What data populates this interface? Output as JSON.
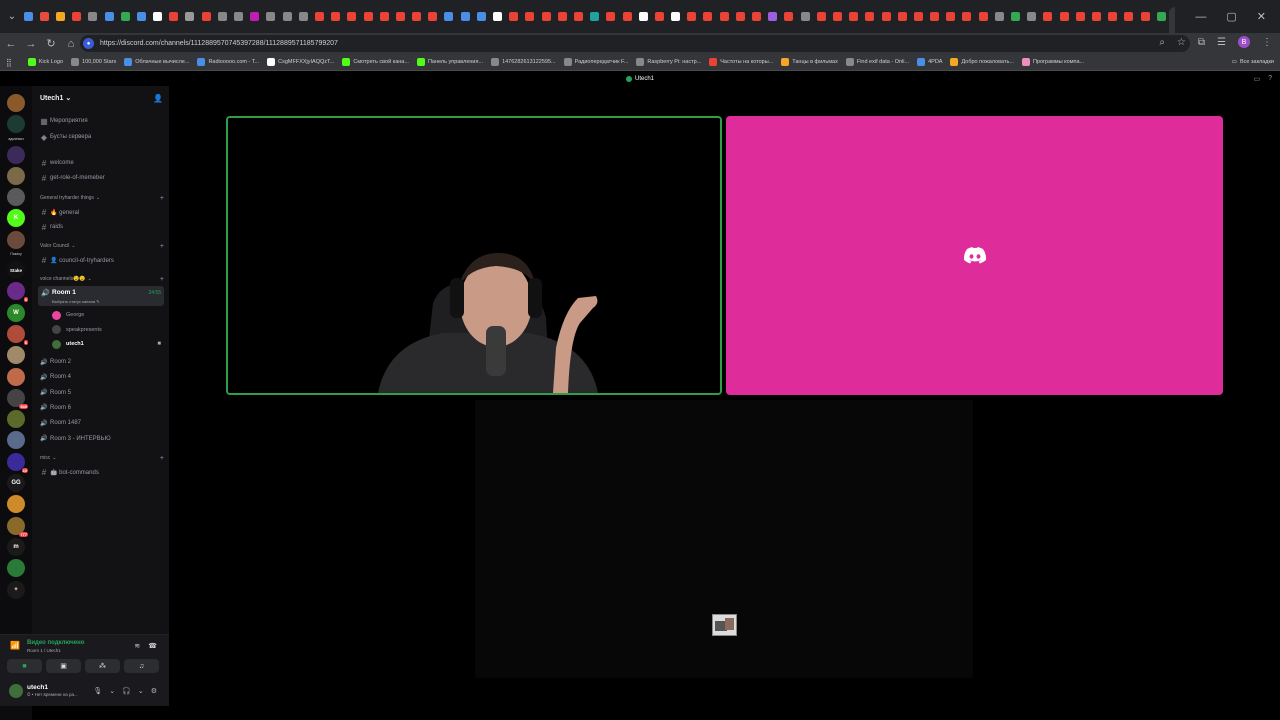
{
  "browser": {
    "url": "https://discord.com/channels/1112889570745397288/1112889571185799207",
    "tab_colors": [
      "#4a8fe7",
      "#e94c3d",
      "#f5a623",
      "#ea4335",
      "#888888",
      "#4a8fe7",
      "#34a853",
      "#4a8fe7",
      "#ffffff",
      "#ea4335",
      "#999999",
      "#ea4335",
      "#888888",
      "#888888",
      "#c21db2",
      "#888888",
      "#888888",
      "#888888",
      "#ea4335",
      "#ea4335",
      "#ea4335",
      "#ea4335",
      "#ea4335",
      "#ea4335",
      "#ea4335",
      "#ea4335",
      "#4a8fe7",
      "#4a8fe7",
      "#4a8fe7",
      "#ffffff",
      "#ea4335",
      "#ea4335",
      "#ea4335",
      "#ea4335",
      "#ea4335",
      "#20a39e",
      "#ea4335",
      "#ea4335",
      "#ffffff",
      "#ea4335",
      "#ffffff",
      "#ea4335",
      "#ea4335",
      "#ea4335",
      "#ea4335",
      "#ea4335",
      "#9c5fe0",
      "#ea4335",
      "#888888",
      "#ea4335",
      "#ea4335",
      "#ea4335",
      "#ea4335",
      "#ea4335",
      "#ea4335",
      "#ea4335",
      "#ea4335",
      "#ea4335",
      "#ea4335",
      "#ea4335",
      "#888888",
      "#34a853",
      "#888888",
      "#ea4335",
      "#ea4335",
      "#ea4335",
      "#ea4335",
      "#ea4335",
      "#ea4335",
      "#ea4335",
      "#34a853"
    ],
    "bookmarks": [
      {
        "label": "Kick Logo",
        "color": "#53fc18"
      },
      {
        "label": "100,000 Stars",
        "color": "#888888"
      },
      {
        "label": "Облачные вычисле...",
        "color": "#4a8fe7"
      },
      {
        "label": "Radiooooo.com - T...",
        "color": "#4a8fe7"
      },
      {
        "label": "CsgMFFXXjyIAQQzT...",
        "color": "#ffffff"
      },
      {
        "label": "Смотреть свой кана...",
        "color": "#53fc18"
      },
      {
        "label": "Панель управления...",
        "color": "#53fc18"
      },
      {
        "label": "1476282613122595...",
        "color": "#888888"
      },
      {
        "label": "Радиопередатчик F...",
        "color": "#888888"
      },
      {
        "label": "Raspberry Pi: настр...",
        "color": "#888888"
      },
      {
        "label": "Частоты на которы...",
        "color": "#ea4335"
      },
      {
        "label": "Танцы в фильмах",
        "color": "#f5a623"
      },
      {
        "label": "Find exif data - Onli...",
        "color": "#888888"
      },
      {
        "label": "4PDA",
        "color": "#4a8fe7"
      },
      {
        "label": "Добро пожаловать...",
        "color": "#f5a623"
      },
      {
        "label": "Программы компа...",
        "color": "#ea8fc0"
      }
    ],
    "bookmarks_right": "Все закладки",
    "profile_letter": "B"
  },
  "discord": {
    "top_title": "Utech1",
    "server_name": "Utech1",
    "servers": [
      {
        "kind": "icon",
        "color": "#8a5a2b",
        "label": "",
        "badge": ""
      },
      {
        "kind": "icon",
        "color": "#1d3b32",
        "label": "",
        "badge": ""
      },
      {
        "kind": "text",
        "label": "админкиз"
      },
      {
        "kind": "icon",
        "color": "#3c2a5a",
        "label": "",
        "badge": ""
      },
      {
        "kind": "icon",
        "color": "#7a6a4a",
        "label": "",
        "badge": ""
      },
      {
        "kind": "icon",
        "color": "#5a5a5a",
        "label": "",
        "badge": ""
      },
      {
        "kind": "icon",
        "color": "#53fc18",
        "label": "K",
        "badge": ""
      },
      {
        "kind": "icon",
        "color": "#6a4a3a",
        "label": "",
        "badge": ""
      },
      {
        "kind": "text",
        "label": "Пикачу"
      },
      {
        "kind": "icon",
        "color": "#111111",
        "label": "Stake",
        "badge": ""
      },
      {
        "kind": "icon",
        "color": "#6a2a8a",
        "label": "",
        "badge": "6"
      },
      {
        "kind": "icon",
        "color": "#2a8a2a",
        "label": "W",
        "badge": ""
      },
      {
        "kind": "icon",
        "color": "#b04a3a",
        "label": "",
        "badge": "6"
      },
      {
        "kind": "icon",
        "color": "#a08a6a",
        "label": "",
        "badge": ""
      },
      {
        "kind": "icon",
        "color": "#c06a4a",
        "label": "",
        "badge": ""
      },
      {
        "kind": "icon",
        "color": "#444444",
        "label": "",
        "badge": "540"
      },
      {
        "kind": "icon",
        "color": "#5a6a2a",
        "label": "",
        "badge": ""
      },
      {
        "kind": "icon",
        "color": "#5a6a8a",
        "label": "",
        "badge": ""
      },
      {
        "kind": "icon",
        "color": "#3a2a9a",
        "label": "",
        "badge": "22"
      },
      {
        "kind": "icon",
        "color": "#1a1a1a",
        "label": "GG",
        "badge": ""
      },
      {
        "kind": "icon",
        "color": "#d08a2a",
        "label": "",
        "badge": ""
      },
      {
        "kind": "icon",
        "color": "#8a6a2a",
        "label": "",
        "badge": "777"
      },
      {
        "kind": "icon",
        "color": "#1a1a1a",
        "label": "m",
        "badge": ""
      },
      {
        "kind": "icon",
        "color": "#2a7a3a",
        "label": "",
        "badge": ""
      },
      {
        "kind": "icon",
        "color": "#1a1a1a",
        "label": "+",
        "badge": ""
      }
    ],
    "top_items": [
      {
        "label": "Мероприятия",
        "icon": "📅"
      },
      {
        "label": "Бусты сервера",
        "icon": "◆"
      }
    ],
    "channels_a": [
      {
        "label": "welcome",
        "icon": "#"
      },
      {
        "label": "get-role-of-memeber",
        "icon": "#"
      }
    ],
    "cat_general": "General tryharder things",
    "channels_b": [
      {
        "label": "🔥 general",
        "icon": "#"
      },
      {
        "label": "raids",
        "icon": "#"
      }
    ],
    "cat_valor": "Valor Council",
    "channels_c": [
      {
        "label": "👤 council-of-tryharders",
        "icon": "#"
      }
    ],
    "cat_voice": "voice channels😉😉",
    "room1": {
      "name": "Room 1",
      "status": "Выбрать статус канала ✎",
      "time": "24:55"
    },
    "members": [
      {
        "name": "George",
        "color": "#eb459e",
        "bold": false
      },
      {
        "name": "speakpresents",
        "color": "#444444",
        "bold": false
      },
      {
        "name": "utech1",
        "color": "#3f6e3c",
        "bold": true
      }
    ],
    "voice_rooms": [
      "Room 2",
      "Room 4",
      "Room 5",
      "Room 6",
      "Room 1487",
      "Room 3 - ИНТЕРВЬЮ"
    ],
    "cat_misc": "misc",
    "channels_misc": [
      {
        "label": "🤖 bot-commands",
        "icon": "#"
      }
    ],
    "voice_panel": {
      "title": "Видео подключено",
      "subtitle": "Room 1 / Utech1"
    },
    "user": {
      "name": "utech1",
      "status": "⏱ • Нет времени на ра..."
    }
  }
}
